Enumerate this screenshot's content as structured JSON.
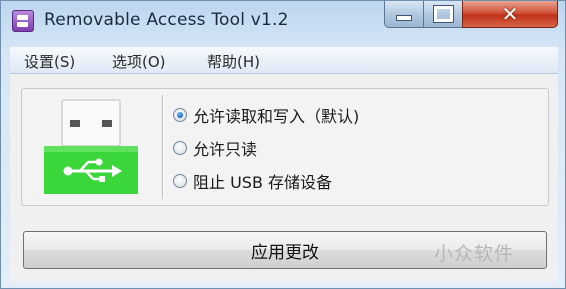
{
  "window": {
    "title": "Removable Access Tool v1.2",
    "close_glyph": "✕"
  },
  "menu": {
    "items": [
      "设置(S)",
      "选项(O)",
      "帮助(H)"
    ]
  },
  "options": {
    "items": [
      {
        "label": "允许读取和写入（默认)",
        "checked": true
      },
      {
        "label": "允许只读",
        "checked": false
      },
      {
        "label": "阻止 USB 存储设备",
        "checked": false
      }
    ]
  },
  "apply": {
    "label": "应用更改"
  },
  "watermark": "小众软件",
  "icons": {
    "app": "usb-tool-icon",
    "graphic": "usb-plug-icon"
  },
  "colors": {
    "usb_green": "#3ad63a",
    "close_red": "#c0321a",
    "radio_blue": "#1f6fc4"
  }
}
